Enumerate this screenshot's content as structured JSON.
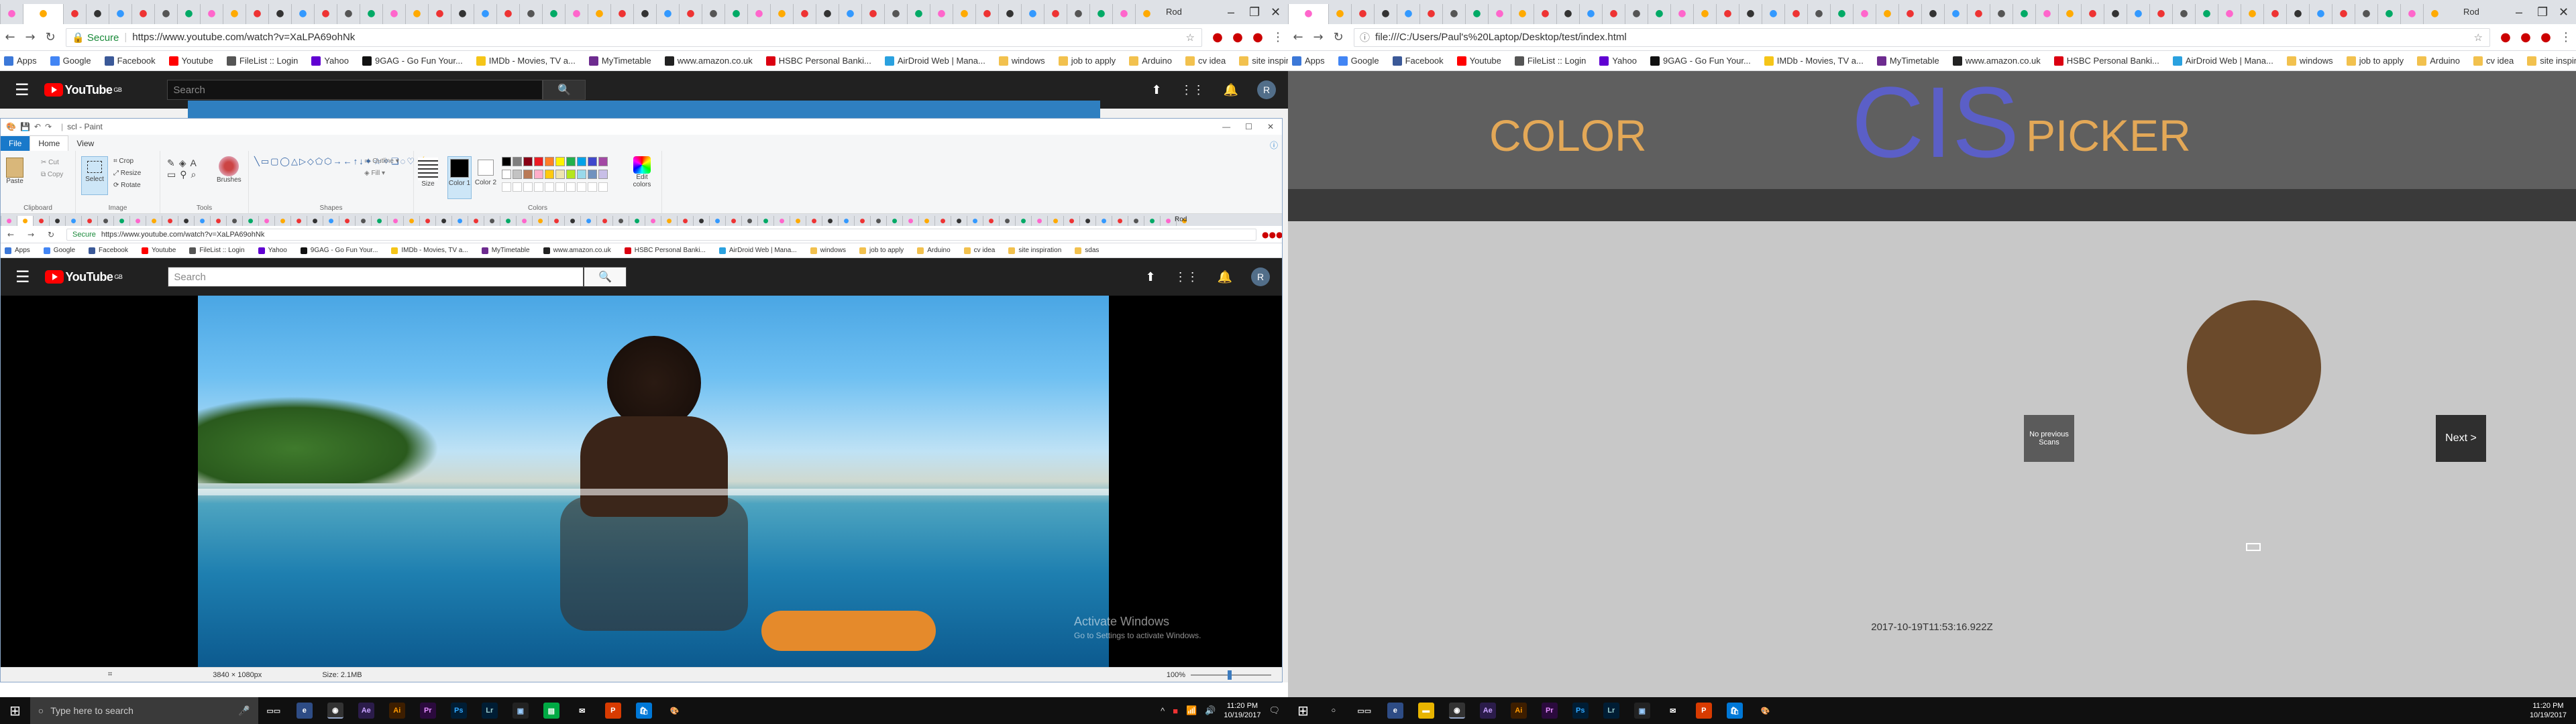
{
  "left_browser": {
    "url": "https://www.youtube.com/watch?v=XaLPA69ohNk",
    "secure_label": "Secure",
    "bookmarks": [
      {
        "label": "Apps",
        "color": "#3c78d8"
      },
      {
        "label": "Google",
        "color": "#4285f4"
      },
      {
        "label": "Facebook",
        "color": "#3b5998"
      },
      {
        "label": "Youtube",
        "color": "#ff0000"
      },
      {
        "label": "FileList :: Login",
        "color": "#555555"
      },
      {
        "label": "Yahoo",
        "color": "#6001d2"
      },
      {
        "label": "9GAG - Go Fun Your...",
        "color": "#111111"
      },
      {
        "label": "IMDb - Movies, TV a...",
        "color": "#f5c518"
      },
      {
        "label": "MyTimetable",
        "color": "#6d2b8f"
      },
      {
        "label": "www.amazon.co.uk",
        "color": "#222222"
      },
      {
        "label": "HSBC Personal Banki...",
        "color": "#db0011"
      },
      {
        "label": "AirDroid Web | Mana...",
        "color": "#2aa1df"
      },
      {
        "label": "windows",
        "color": "#f2c14e"
      },
      {
        "label": "job to apply",
        "color": "#f2c14e"
      },
      {
        "label": "Arduino",
        "color": "#f2c14e"
      },
      {
        "label": "cv idea",
        "color": "#f2c14e"
      },
      {
        "label": "site inspiration",
        "color": "#f2c14e"
      },
      {
        "label": "sdas",
        "color": "#f2c14e"
      }
    ],
    "profile_name": "Rod"
  },
  "youtube": {
    "logo_text": "YouTube",
    "logo_region": "GB",
    "search_placeholder": "Search",
    "avatar_letter": "R"
  },
  "paint": {
    "title": "scl - Paint",
    "tabs": {
      "file": "File",
      "home": "Home",
      "view": "View"
    },
    "groups": {
      "clipboard": "Clipboard",
      "image": "Image",
      "tools": "Tools",
      "shapes": "Shapes",
      "colors": "Colors"
    },
    "clipboard_items": {
      "paste": "Paste",
      "cut": "Cut",
      "copy": "Copy"
    },
    "image_items": {
      "select": "Select",
      "crop": "Crop",
      "resize": "Resize",
      "rotate": "Rotate"
    },
    "brushes": "Brushes",
    "outline": "Outline",
    "fill": "Fill",
    "size": "Size",
    "color1": "Color 1",
    "color2": "Color 2",
    "edit_colors": "Edit colors",
    "status": {
      "dimensions": "3840 × 1080px",
      "size": "Size: 2.1MB",
      "zoom": "100%"
    },
    "palette": [
      "#000000",
      "#7f7f7f",
      "#880015",
      "#ed1c24",
      "#ff7f27",
      "#fff200",
      "#22b14c",
      "#00a2e8",
      "#3f48cc",
      "#a349a4",
      "#ffffff",
      "#c3c3c3",
      "#b97a57",
      "#ffaec9",
      "#ffc90e",
      "#efe4b0",
      "#b5e61d",
      "#99d9ea",
      "#7092be",
      "#c8bfe7"
    ]
  },
  "activate_windows": {
    "title": "Activate Windows",
    "subtitle": "Go to Settings to activate Windows."
  },
  "left_taskbar": {
    "search_placeholder": "Type here to search",
    "time": "11:20 PM",
    "date": "10/19/2017"
  },
  "right_browser": {
    "url": "file:///C:/Users/Paul's%20Laptop/Desktop/test/index.html",
    "profile_name": "Rod"
  },
  "cis_app": {
    "word_color": "COLOR",
    "word_cis": "CIS",
    "word_picker": "PICKER",
    "title_color": "#e3a857",
    "logo_color": "#5b5fc7",
    "previous_button": "No previous Scans",
    "next_button": "Next >",
    "scanned_color": "#6b4a2b",
    "timestamp": "2017-10-19T11:53:16.922Z"
  },
  "right_taskbar": {
    "time": "11:20 PM",
    "date": "10/19/2017"
  }
}
